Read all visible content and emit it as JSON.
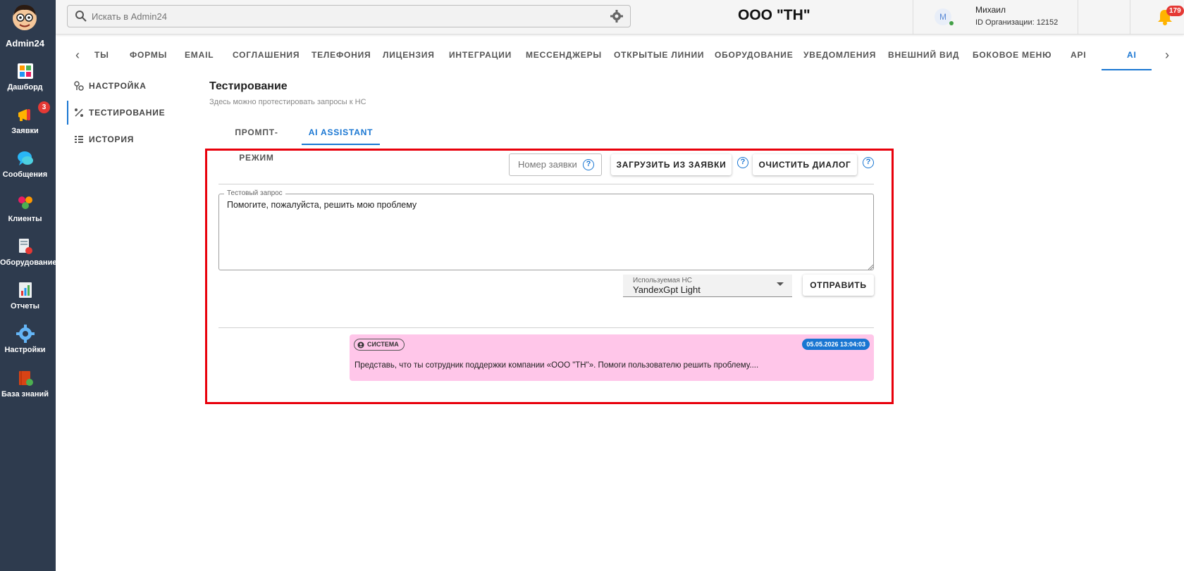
{
  "app": {
    "name": "Admin24",
    "org_title": "ООО \"ТН\""
  },
  "sidebar": {
    "items": [
      {
        "label": "Дашборд",
        "icon": "dashboard-icon"
      },
      {
        "label": "Заявки",
        "icon": "megaphone-icon",
        "badge": "3"
      },
      {
        "label": "Сообщения",
        "icon": "chat-icon"
      },
      {
        "label": "Клиенты",
        "icon": "clients-icon"
      },
      {
        "label": "Оборудование",
        "icon": "equipment-icon"
      },
      {
        "label": "Отчеты",
        "icon": "reports-icon"
      },
      {
        "label": "Настройки",
        "icon": "gear-icon"
      },
      {
        "label": "База знаний",
        "icon": "knowledge-base-icon"
      }
    ]
  },
  "header": {
    "search_placeholder": "Искать в Admin24",
    "user_initial": "M",
    "user_name": "Михаил",
    "user_org": "ID Организации: 12152",
    "notifications_count": "179",
    "help_label": "?"
  },
  "top_tabs": {
    "items": [
      "ТЫ",
      "ФОРМЫ",
      "EMAIL",
      "СОГЛАШЕНИЯ",
      "ТЕЛЕФОНИЯ",
      "ЛИЦЕНЗИЯ",
      "ИНТЕГРАЦИИ",
      "МЕССЕНДЖЕРЫ",
      "ОТКРЫТЫЕ ЛИНИИ",
      "ОБОРУДОВАНИЕ",
      "УВЕДОМЛЕНИЯ",
      "ВНЕШНИЙ ВИД",
      "БОКОВОЕ МЕНЮ",
      "API",
      "AI"
    ],
    "active": "AI"
  },
  "subnav": {
    "items": [
      "НАСТРОЙКА",
      "ТЕСТИРОВАНИЕ",
      "ИСТОРИЯ"
    ],
    "active": "ТЕСТИРОВАНИЕ"
  },
  "main": {
    "title": "Тестирование",
    "subtitle": "Здесь можно протестировать запросы к НС",
    "subtabs": [
      "ПРОМПТ-РЕЖИМ",
      "AI ASSISTANT"
    ],
    "active_subtab": "AI ASSISTANT",
    "ticket_number_placeholder": "Номер заявки",
    "load_button": "ЗАГРУЗИТЬ ИЗ ЗАЯВКИ",
    "clear_button": "ОЧИСТИТЬ ДИАЛОГ",
    "query_label": "Тестовый запрос",
    "query_value": "Помогите, пожалуйста, решить мою проблему",
    "model_label": "Используемая НС",
    "model_value": "YandexGpt Light",
    "send_button": "ОТПРАВИТЬ",
    "message": {
      "role": "СИСТЕМА",
      "timestamp": "05.05.2026 13:04:03",
      "text": "Представь, что ты сотрудник поддержки компании «ООО \"ТН\"». Помоги пользователю решить проблему...."
    }
  },
  "colors": {
    "sidebar_bg": "#2e3b4e",
    "accent": "#1976d2",
    "highlight_border": "#e8000b",
    "message_bg": "#ffc6e9",
    "badge_red": "#e53935"
  }
}
